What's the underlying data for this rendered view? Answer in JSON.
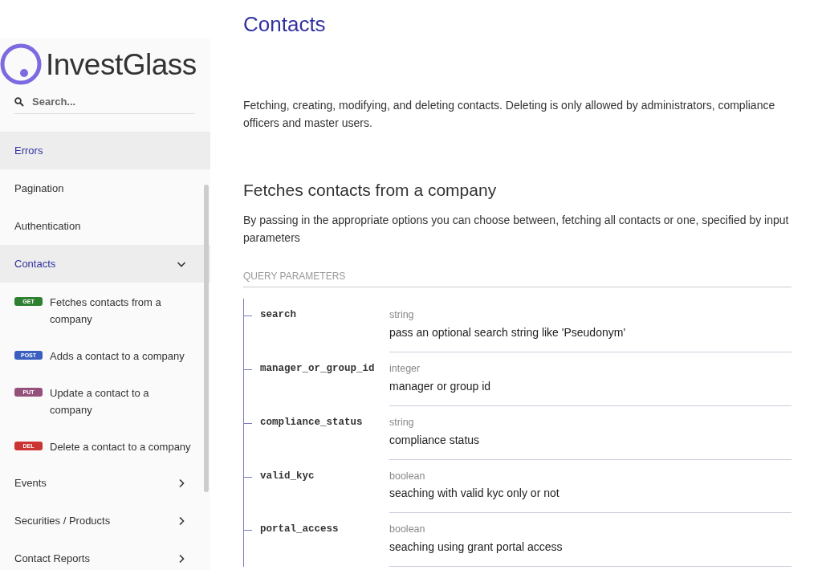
{
  "sidebar": {
    "logo": {
      "text": "InvestGlass"
    },
    "search": {
      "placeholder": "Search..."
    },
    "items": [
      {
        "label": "Errors",
        "selected": true
      },
      {
        "label": "Pagination",
        "selected": false
      },
      {
        "label": "Authentication",
        "selected": false
      },
      {
        "label": "Contacts",
        "selected": true,
        "expanded": true,
        "children": [
          {
            "method": "GET",
            "label": "Fetches contacts from a company"
          },
          {
            "method": "POST",
            "label": "Adds a contact to a company"
          },
          {
            "method": "PUT",
            "label": "Update a contact to a company"
          },
          {
            "method": "DEL",
            "label": "Delete a contact to a company"
          }
        ]
      },
      {
        "label": "Events",
        "selected": false,
        "expanded": false
      },
      {
        "label": "Securities / Products",
        "selected": false,
        "expanded": false
      },
      {
        "label": "Contact Reports",
        "selected": false,
        "expanded": false
      }
    ]
  },
  "main": {
    "title": "Contacts",
    "description": "Fetching, creating, modifying, and deleting contacts. Deleting is only allowed by administrators, compliance officers and master users.",
    "operation": {
      "title": "Fetches contacts from a company",
      "description": "By passing in the appropriate options you can choose between, fetching all contacts or one, specified by input parameters",
      "params_heading": "QUERY PARAMETERS",
      "params": [
        {
          "name": "search",
          "type": "string",
          "description": "pass an optional search string like 'Pseudonym'"
        },
        {
          "name": "manager_or_group_id",
          "type": "integer",
          "description": "manager or group id"
        },
        {
          "name": "compliance_status",
          "type": "string",
          "description": "compliance status"
        },
        {
          "name": "valid_kyc",
          "type": "boolean",
          "description": "seaching with valid kyc only or not"
        },
        {
          "name": "portal_access",
          "type": "boolean",
          "description": "seaching using grant portal access"
        }
      ]
    }
  }
}
